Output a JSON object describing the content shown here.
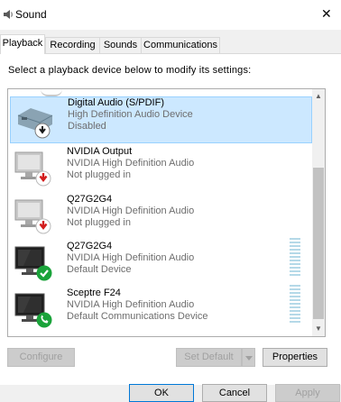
{
  "window": {
    "title": "Sound",
    "close_glyph": "✕"
  },
  "tabs": [
    {
      "label": "Playback",
      "active": true
    },
    {
      "label": "Recording",
      "active": false
    },
    {
      "label": "Sounds",
      "active": false
    },
    {
      "label": "Communications",
      "active": false
    }
  ],
  "instruction": "Select a playback device below to modify its settings:",
  "devices": [
    {
      "name": "Digital Audio (S/PDIF)",
      "description": "High Definition Audio Device",
      "status": "Disabled",
      "icon": "spdif-box-icon",
      "badge": "disabled-arrow-icon",
      "selected": true
    },
    {
      "name": "NVIDIA Output",
      "description": "NVIDIA High Definition Audio",
      "status": "Not plugged in",
      "icon": "monitor-icon",
      "badge": "unplugged-red-arrow-icon",
      "selected": false
    },
    {
      "name": "Q27G2G4",
      "description": "NVIDIA High Definition Audio",
      "status": "Not plugged in",
      "icon": "monitor-icon",
      "badge": "unplugged-red-arrow-icon",
      "selected": false
    },
    {
      "name": "Q27G2G4",
      "description": "NVIDIA High Definition Audio",
      "status": "Default Device",
      "icon": "monitor-icon",
      "badge": "default-green-check-icon",
      "selected": false,
      "level_meter": true
    },
    {
      "name": "Sceptre F24",
      "description": "NVIDIA High Definition Audio",
      "status": "Default Communications Device",
      "icon": "monitor-icon",
      "badge": "communications-green-phone-icon",
      "selected": false,
      "level_meter": true
    }
  ],
  "buttons": {
    "configure": "Configure",
    "set_default": "Set Default",
    "properties": "Properties"
  },
  "footer": {
    "ok": "OK",
    "cancel": "Cancel",
    "apply": "Apply"
  },
  "colors": {
    "selection": "#cce8ff",
    "selection_border": "#99d1ff",
    "default_check": "#1aa33a",
    "unplugged": "#d21c1c",
    "focus_border": "#0078d7"
  }
}
